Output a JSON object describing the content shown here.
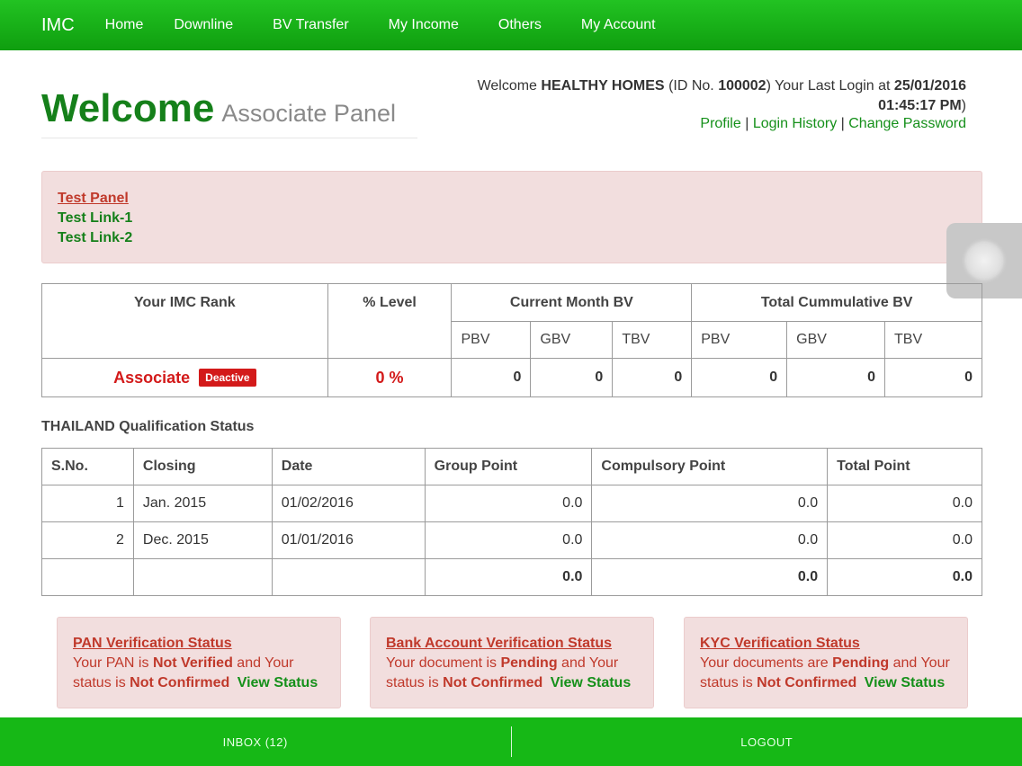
{
  "nav": {
    "brand": "IMC",
    "items": [
      "Home",
      "Downline",
      "BV Transfer",
      "My Income",
      "Others",
      "My Account"
    ]
  },
  "header": {
    "title": "Welcome",
    "subtitle": "Associate Panel",
    "welcome_prefix": "Welcome",
    "user_name": "HEALTHY HOMES",
    "id_label": "(ID No.",
    "id_value": "100002",
    "last_login_label": ") Your Last Login at",
    "last_login_date": "25/01/2016",
    "last_login_time": "01:45:17 PM",
    "close_paren": ")",
    "links": [
      "Profile",
      "Login History",
      "Change Password"
    ],
    "sep": "|"
  },
  "test_panel": {
    "title": "Test Panel",
    "links": [
      "Test Link-1",
      "Test Link-2"
    ]
  },
  "rank_table": {
    "headers": {
      "rank": "Your IMC Rank",
      "level": "% Level",
      "current": "Current Month BV",
      "total": "Total Cummulative BV"
    },
    "sub_headers": [
      "PBV",
      "GBV",
      "TBV",
      "PBV",
      "GBV",
      "TBV"
    ],
    "rank": "Associate",
    "status": "Deactive",
    "level": "0 %",
    "values": [
      "0",
      "0",
      "0",
      "0",
      "0",
      "0"
    ]
  },
  "qualification": {
    "title": "THAILAND Qualification Status",
    "columns": [
      "S.No.",
      "Closing",
      "Date",
      "Group Point",
      "Compulsory Point",
      "Total Point"
    ],
    "rows": [
      [
        "1",
        "Jan. 2015",
        "01/02/2016",
        "0.0",
        "0.0",
        "0.0"
      ],
      [
        "2",
        "Dec. 2015",
        "01/01/2016",
        "0.0",
        "0.0",
        "0.0"
      ]
    ],
    "totals": [
      "0.0",
      "0.0",
      "0.0"
    ]
  },
  "status_boxes": [
    {
      "title": "PAN Verification Status",
      "line1_a": "Your PAN is ",
      "line1_b": "Not Verified",
      "line1_c": " and Your",
      "line2_a": "status is ",
      "line2_b": "Not Confirmed",
      "link": "View Status"
    },
    {
      "title": "Bank Account Verification Status",
      "line1_a": "Your document is ",
      "line1_b": "Pending",
      "line1_c": " and Your",
      "line2_a": "status is ",
      "line2_b": "Not Confirmed",
      "link": "View Status"
    },
    {
      "title": "KYC Verification Status",
      "line1_a": "Your documents are ",
      "line1_b": "Pending",
      "line1_c": " and Your",
      "line2_a": "status is ",
      "line2_b": "Not Confirmed",
      "link": "View Status"
    }
  ],
  "bottom_bar": {
    "inbox": "INBOX (12)",
    "logout": "LOGOUT"
  }
}
